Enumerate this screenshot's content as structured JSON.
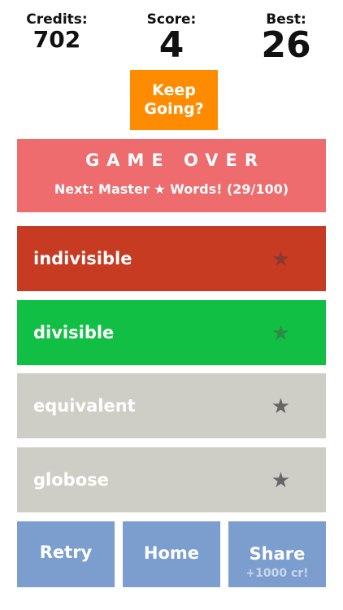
{
  "stats": {
    "credits_label": "Credits:",
    "credits_value": "702",
    "score_label": "Score:",
    "score_value": "4",
    "best_label": "Best:",
    "best_value": "26"
  },
  "keep_going": {
    "line1": "Keep",
    "line2": "Going?"
  },
  "game_over": {
    "title": "GAME OVER",
    "next": "Next: Master ★ Words! (29/100)"
  },
  "words": [
    {
      "label": "indivisible",
      "star": "★",
      "bg": "#c73b22",
      "star_color": "#8a3a30"
    },
    {
      "label": "divisible",
      "star": "★",
      "bg": "#12bf45",
      "star_color": "#2f8c45"
    },
    {
      "label": "equivalent",
      "star": "★",
      "bg": "#cfcec6",
      "star_color": "#666666"
    },
    {
      "label": "globose",
      "star": "★",
      "bg": "#cfcec6",
      "star_color": "#666666"
    }
  ],
  "buttons": {
    "retry": "Retry",
    "home": "Home",
    "share": "Share",
    "share_sub": "+1000 cr!"
  },
  "colors": {
    "keep_going": "#ff8c00",
    "game_over_panel": "#ee6b6e",
    "buttons": "#7b9ecf",
    "share_sub_text": "#c9d6ea"
  }
}
